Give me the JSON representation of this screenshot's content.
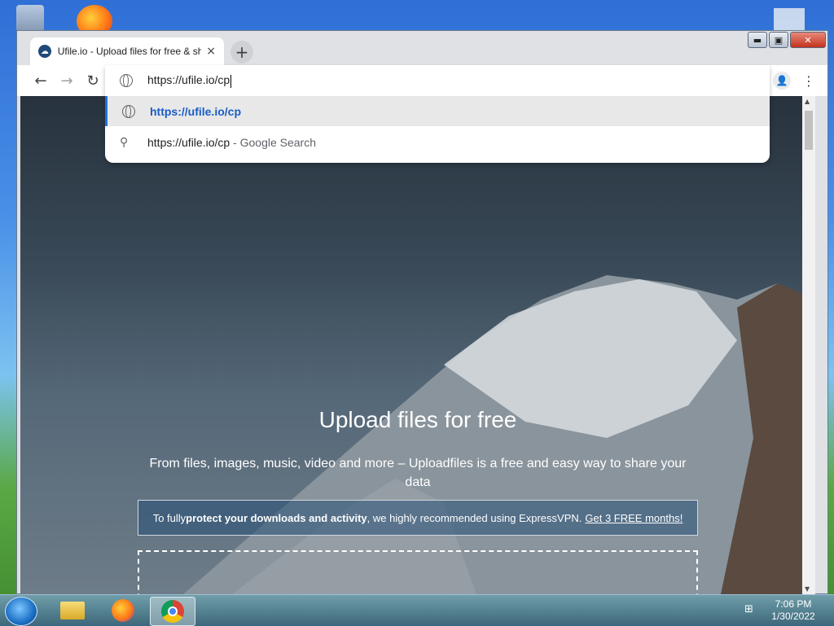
{
  "browser": {
    "tab_title": "Ufile.io - Upload files for free & share",
    "tab_close": "×",
    "new_tab": "+",
    "window_controls": {
      "minimize": "▬",
      "maximize": "▣",
      "close": "✕"
    },
    "nav": {
      "back": "←",
      "forward": "→",
      "reload": "↻",
      "menu": "⋮",
      "profile": "👤"
    }
  },
  "omnibox": {
    "typed": "https://ufile.io/cp",
    "suggestions": [
      {
        "text": "https://ufile.io/cp",
        "suffix": ""
      },
      {
        "text": "https://ufile.io/cp",
        "suffix": " - Google Search"
      }
    ],
    "search_icon": "⚲"
  },
  "page": {
    "title": "Upload files for free",
    "subtitle": "From files, images, music, video and more – Uploadfiles is a free and easy way to share your data",
    "banner": {
      "prefix": "To fully ",
      "bold": "protect your downloads and activity",
      "middle": ", we highly recommended using ExpressVPN.",
      "link": "Get 3 FREE months!"
    }
  },
  "taskbar": {
    "time": "7:06 PM",
    "date": "1/30/2022"
  },
  "colors": {
    "accent": "#1a73e8",
    "suggestion_link": "#1a5dc6"
  }
}
